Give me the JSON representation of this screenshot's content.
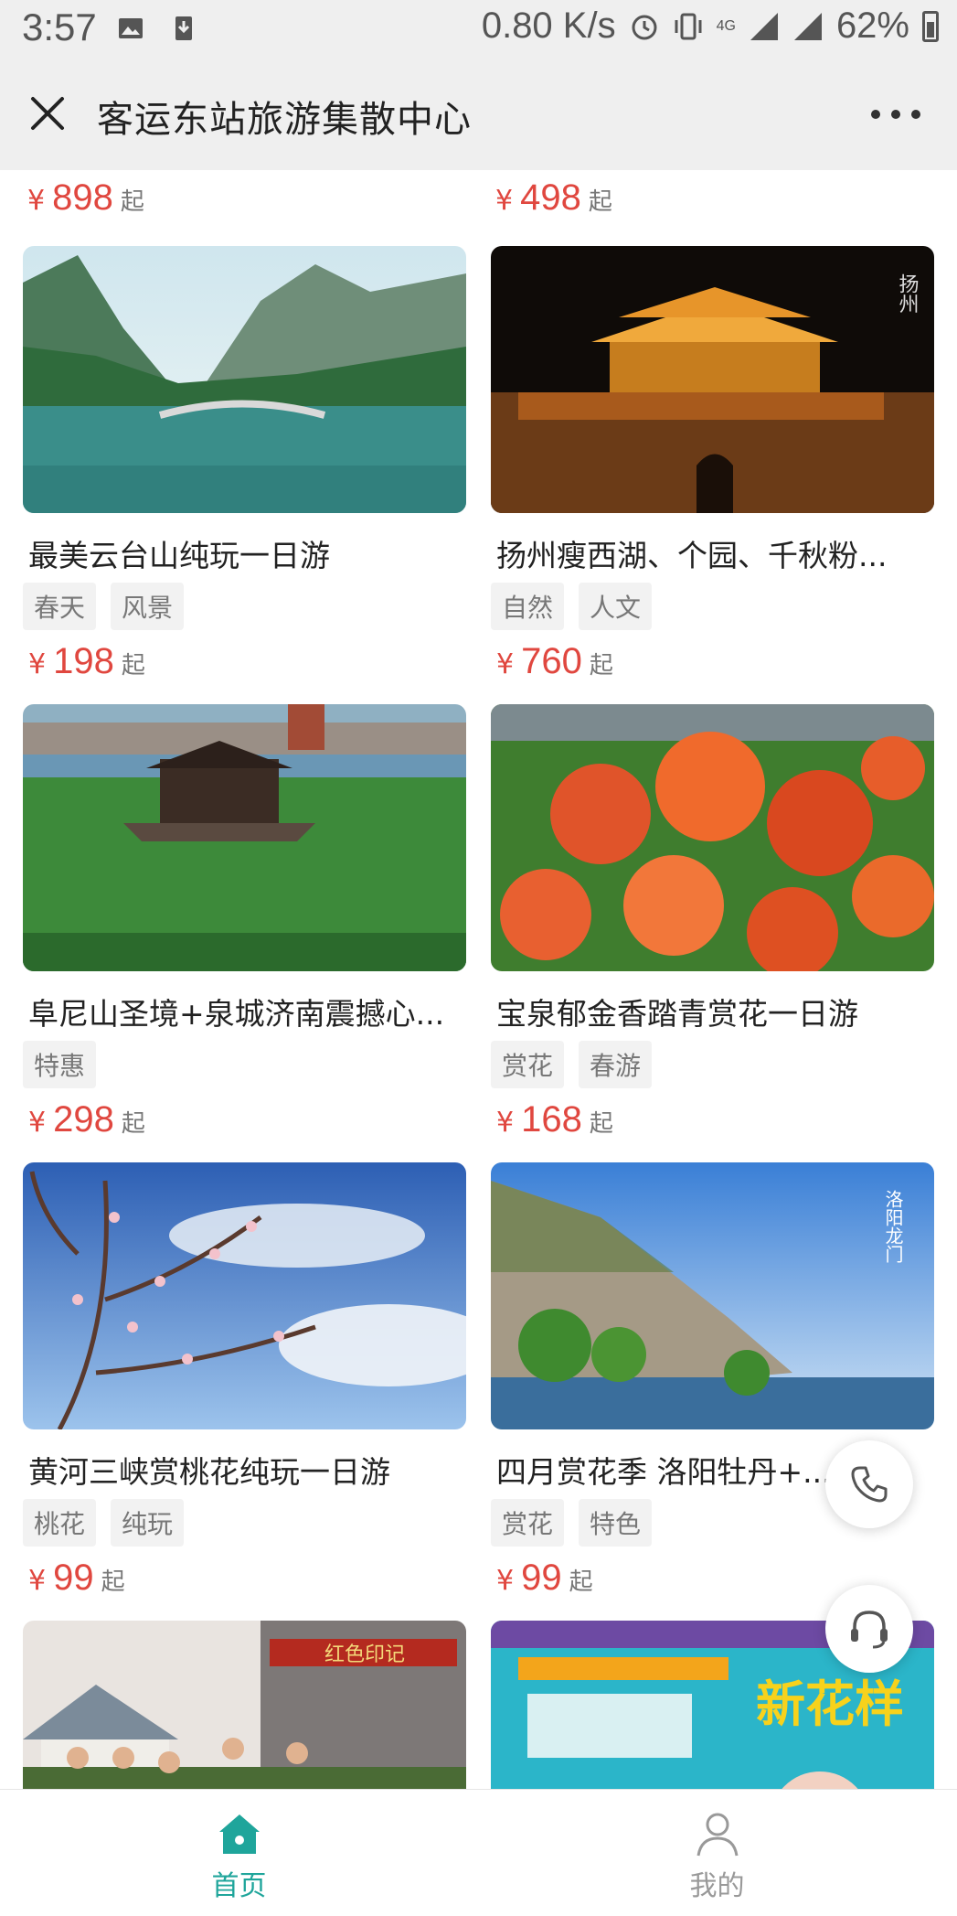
{
  "status_bar": {
    "time": "3:57",
    "network_speed": "0.80 K/s",
    "network_type": "4G",
    "battery": "62%"
  },
  "title_bar": {
    "title": "客运东站旅游集散中心"
  },
  "currency": "¥",
  "price_suffix": "起",
  "top_prices": [
    "898",
    "498"
  ],
  "products": [
    {
      "name": "最美云台山纯玩一日游",
      "tags": [
        "春天",
        "风景"
      ],
      "price": "198"
    },
    {
      "name": "扬州瘦西湖、个园、千秋粉...",
      "tags": [
        "自然",
        "人文"
      ],
      "price": "760"
    },
    {
      "name": "阜尼山圣境+泉城济南震撼心...",
      "tags": [
        "特惠"
      ],
      "price": "298"
    },
    {
      "name": "宝泉郁金香踏青赏花一日游",
      "tags": [
        "赏花",
        "春游"
      ],
      "price": "168"
    },
    {
      "name": "黄河三峡赏桃花纯玩一日游",
      "tags": [
        "桃花",
        "纯玩"
      ],
      "price": "99"
    },
    {
      "name": "四月赏花季 洛阳牡丹+...",
      "tags": [
        "赏花",
        "特色"
      ],
      "price": "99"
    }
  ],
  "image_text": {
    "yangzhou": "扬州",
    "luoyang": "洛阳龙门",
    "red_banner": "红色印记",
    "poster_title": "新花样"
  },
  "tab_bar": {
    "home_label": "首页",
    "mine_label": "我的"
  },
  "colors": {
    "accent": "#1fa59b",
    "price": "#e0473f",
    "header_bg": "#efefef"
  },
  "icons": {
    "close": "close-icon",
    "more": "more-dots-icon",
    "phone": "phone-icon",
    "service": "customer-service-icon",
    "home": "home-icon",
    "mine": "user-icon"
  }
}
